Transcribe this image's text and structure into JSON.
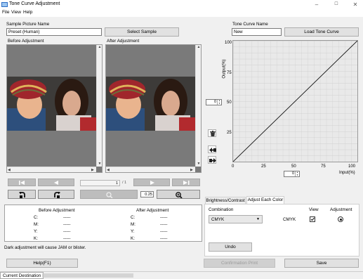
{
  "window": {
    "title": "Tone Curve Adjustment",
    "minimize": "–",
    "maximize": "☐",
    "close": "✕"
  },
  "menu": [
    "File",
    "View",
    "Help"
  ],
  "sample": {
    "label": "Sample Picture Name",
    "value": "Preset (Human)",
    "select_button": "Select Sample"
  },
  "preview": {
    "before_label": "Before Adjustment",
    "after_label": "After Adjustment"
  },
  "pager": {
    "current": "1",
    "total": "/ 1"
  },
  "zoom": {
    "value": "0.25"
  },
  "info": {
    "before_title": "Before Adjustment",
    "after_title": "After Adjustment",
    "rows": [
      {
        "ch": "C:",
        "before": "-----",
        "after": "-----"
      },
      {
        "ch": "M:",
        "before": "-----",
        "after": "-----"
      },
      {
        "ch": "Y:",
        "before": "-----",
        "after": "-----"
      },
      {
        "ch": "K:",
        "before": "-----",
        "after": "-----"
      }
    ]
  },
  "warning": "Dark adjustment will cause JAM or blister.",
  "buttons": {
    "help": "Help(F1)",
    "confirmation": "Confirmation Print",
    "save": "Save",
    "undo": "Undo",
    "load": "Load Tone Curve"
  },
  "curve": {
    "name_label": "Tone Curve Name",
    "name_value": "New",
    "output_label": "Output(%)",
    "input_label": "Input(%)",
    "y_ticks": [
      "100",
      "75",
      "50",
      "25"
    ],
    "x_ticks": [
      "0",
      "25",
      "50",
      "75",
      "100"
    ],
    "output_spin": "0",
    "input_spin": "0"
  },
  "tabs": {
    "brightness": "Brightness/Contrast",
    "adjust": "Adjust Each Color"
  },
  "adjust": {
    "combination_label": "Combination",
    "view_label": "View",
    "adjustment_label": "Adjustment",
    "combination_value": "CMYK",
    "channel": "CMYK"
  },
  "status": {
    "destination": "Current Destination"
  }
}
